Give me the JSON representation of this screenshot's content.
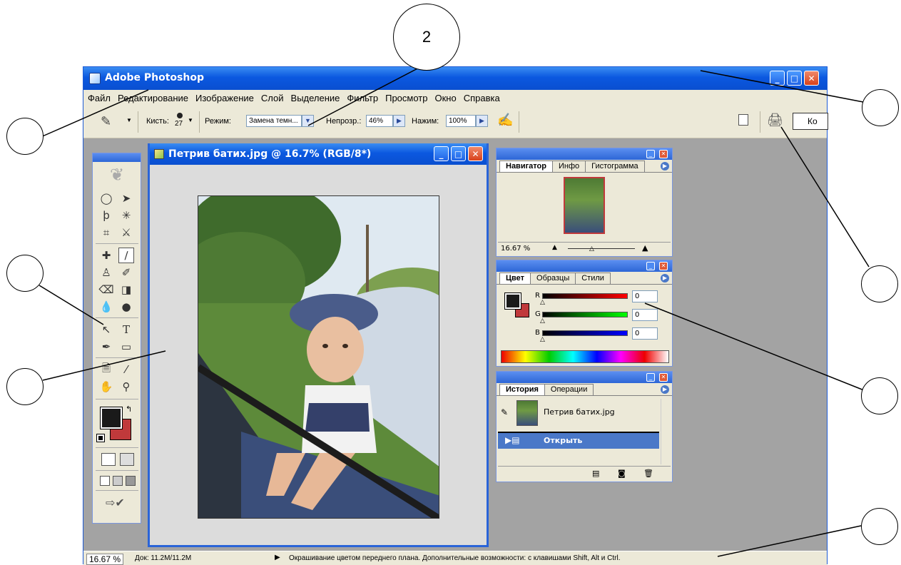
{
  "callouts": {
    "c2": "2",
    "c1": "",
    "c3": "",
    "c4": "",
    "c5": "",
    "c6": "",
    "c7": ""
  },
  "app": {
    "title": "Adobe Photoshop",
    "minimize": "_",
    "maximize": "□",
    "close": "✕"
  },
  "menu": [
    "Файл",
    "Редактирование",
    "Изображение",
    "Слой",
    "Выделение",
    "Фильтр",
    "Просмотр",
    "Окно",
    "Справка"
  ],
  "options": {
    "brush_label": "Кисть:",
    "brush_size": "27",
    "mode_label": "Режим:",
    "mode_value": "Замена темн...",
    "opacity_label": "Непрозр.:",
    "opacity_value": "46%",
    "flow_label": "Нажим:",
    "flow_value": "100%",
    "palette_well_label": "Ко"
  },
  "document": {
    "title": "Петрив батих.jpg @ 16.7% (RGB/8*)"
  },
  "navigator": {
    "tabs": [
      "Навигатор",
      "Инфо",
      "Гистограмма"
    ],
    "zoom": "16.67 %"
  },
  "color": {
    "tabs": [
      "Цвет",
      "Образцы",
      "Стили"
    ],
    "r_label": "R",
    "g_label": "G",
    "b_label": "B",
    "r_value": "0",
    "g_value": "0",
    "b_value": "0"
  },
  "history": {
    "tabs": [
      "История",
      "Операции"
    ],
    "snapshot": "Петрив батих.jpg",
    "step": "Открыть"
  },
  "status": {
    "zoom": "16.67 %",
    "doc": "Док: 11.2M/11.2M",
    "message": "Окрашивание цветом переднего плана. Дополнительные возможности: с клавишами Shift, Alt и Ctrl."
  },
  "colors": {
    "foreground": "#1a1a1a",
    "background": "#c0393b",
    "title_blue": "#0b58e0",
    "history_selected": "#4a78c8"
  }
}
